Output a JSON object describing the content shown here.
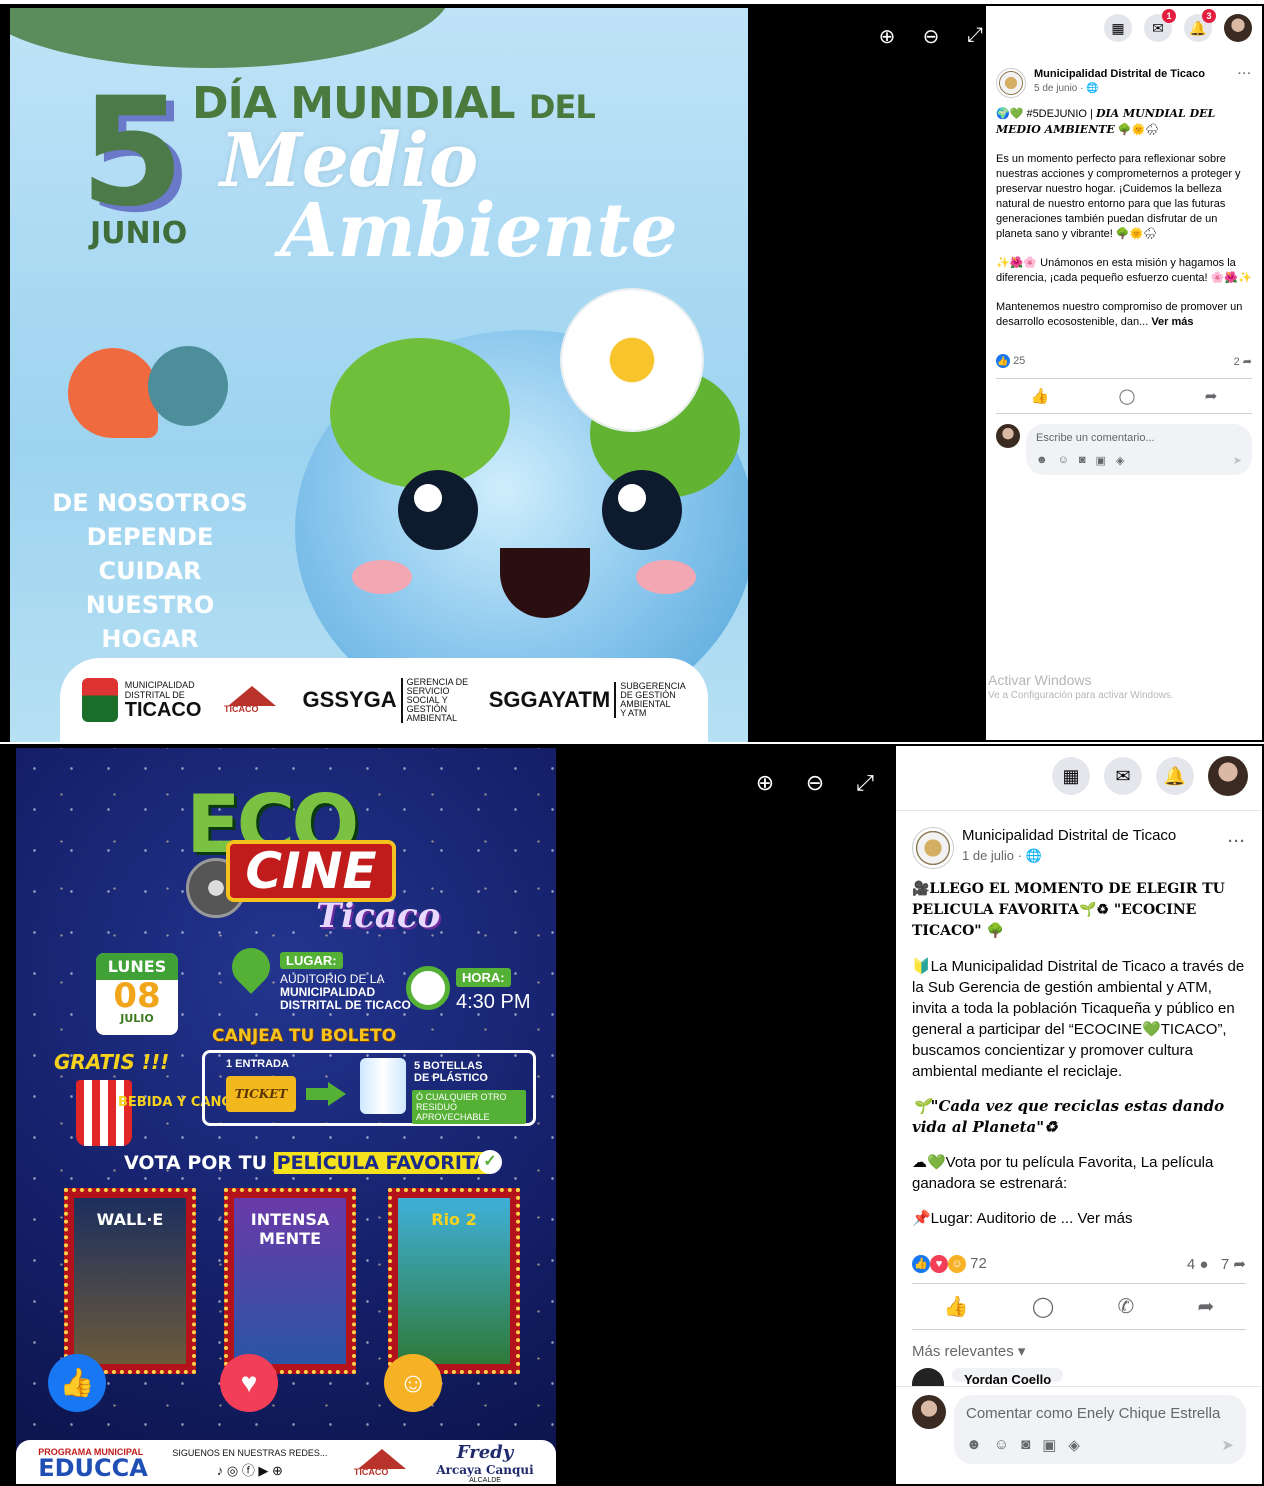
{
  "shot1": {
    "viewer_tools": {
      "zoom_in": "⊕",
      "zoom_out": "⊖",
      "fullscreen": "⤢"
    },
    "poster": {
      "day": "5",
      "month": "JUNIO",
      "title_line1": "DÍA MUNDIAL",
      "title_del": "DEL",
      "title_medio": "Medio",
      "title_ambiente": "Ambiente",
      "slogan": [
        "DE NOSOTROS",
        "DEPENDE CUIDAR",
        "NUESTRO HOGAR"
      ],
      "footer": {
        "muni_top": "MUNICIPALIDAD",
        "muni_mid": "DISTRITAL DE",
        "muni_name": "TICACO",
        "ticaco_logo": "TICACO",
        "gssyga": "GSSYGA",
        "gssyga_desc": [
          "GERENCIA DE",
          "SERVICIO",
          "SOCIAL Y",
          "GESTIÓN",
          "AMBIENTAL"
        ],
        "sggayatm": "SGGAYATM",
        "sggayatm_desc": [
          "SUBGERENCIA",
          "DE GESTIÓN",
          "AMBIENTAL",
          "Y ATM"
        ]
      }
    },
    "topbar": {
      "messenger_badge": "1",
      "notif_badge": "3"
    },
    "post": {
      "page_name": "Municipalidad Distrital de Ticaco",
      "date": "5 de junio · ",
      "heading": "🌍💚 #5DEJUNIO | ",
      "heading_em": "DIA MUNDIAL DEL MEDIO AMBIENTE",
      "heading_tail": " 🌳🌞🌧",
      "p1": "Es un momento perfecto para reflexionar sobre nuestras acciones y comprometernos a proteger y preservar nuestro hogar. ¡Cuidemos la belleza natural de nuestro entorno para que las futuras generaciones también puedan disfrutar de un planeta sano y vibrante! 🌳🌞🌧",
      "p2": "✨🌺🌸 Unámonos en esta misión y hagamos la diferencia, ¡cada pequeño esfuerzo cuenta! 🌸🌺✨",
      "p3": "Mantenemos nuestro compromiso de promover un desarrollo ecosostenible, dan... ",
      "more": "Ver más",
      "reactions": "25",
      "shares": "2",
      "comment_placeholder": "Escribe un comentario..."
    },
    "watermark": {
      "line1": "Activar Windows",
      "line2": "Ve a Configuración para activar Windows."
    }
  },
  "shot2": {
    "viewer_tools": {
      "zoom_in": "⊕",
      "zoom_out": "⊖",
      "fullscreen": "⤢"
    },
    "poster": {
      "eco": "ECO",
      "cine": "CINE",
      "town": "Ticaco",
      "cal_day": "LUNES",
      "cal_num": "08",
      "cal_month": "JULIO",
      "lugar_tag": "LUGAR:",
      "lugar_l1": "AUDITORIO DE LA",
      "lugar_l2": "MUNICIPALIDAD",
      "lugar_l3": "DISTRITAL DE TICACO",
      "hora_tag": "HORA:",
      "hora": "4:30 PM",
      "canjea": "CANJEA TU BOLETO",
      "gratis": "GRATIS !!!",
      "bebida": "BEBIDA Y CANCHITA",
      "entrada": "1 ENTRADA",
      "ticket": "TICKET",
      "botellas_l1": "5 BOTELLAS",
      "botellas_l2": "DE PLÁSTICO",
      "residuo": "Ó CUALQUIER OTRO RESIDUO APROVECHABLE",
      "vota": "VOTA POR TU ",
      "vota_hl": "PELÍCULA FAVORITA",
      "movies": [
        "WALL·E",
        "INTENSA MENTE",
        "Rio 2"
      ],
      "footer": {
        "educca_top": "PROGRAMA MUNICIPAL",
        "educca": "EDUCCA",
        "siguenos": "SIGUENOS EN NUESTRAS REDES...",
        "ticaco_logo": "TICACO",
        "sig_name": "Fredy",
        "sig_full": "Arcaya Canqui",
        "sig_role": "ALCALDE"
      }
    },
    "post": {
      "page_name": "Municipalidad Distrital de Ticaco",
      "date": "1 de julio · ",
      "heading": "🎥LLEGO EL MOMENTO DE ELEGIR TU PELICULA FAVORITA🌱♻ \"ECOCINE TICACO\" 🌳",
      "p1": "🔰La Municipalidad Distrital de Ticaco a través de la Sub Gerencia de gestión ambiental y ATM, invita a toda la población Ticaqueña y público en general a participar del “ECOCINE💚TICACO”, buscamos concientizar y promover cultura ambiental mediante el reciclaje.",
      "quote": "🌱\"Cada vez que reciclas estas dando vida al Planeta\"♻",
      "p3": "☁💚Vota por tu película Favorita, La película ganadora se estrenará:",
      "p4": "📌Lugar: Auditorio de ... ",
      "more": "Ver más",
      "reactions": "72",
      "comments": "4",
      "shares": "7",
      "sort": "Más relevantes",
      "comment_author": "Yordan Coello",
      "comment_placeholder": "Comentar como Enely Chique Estrella"
    }
  }
}
